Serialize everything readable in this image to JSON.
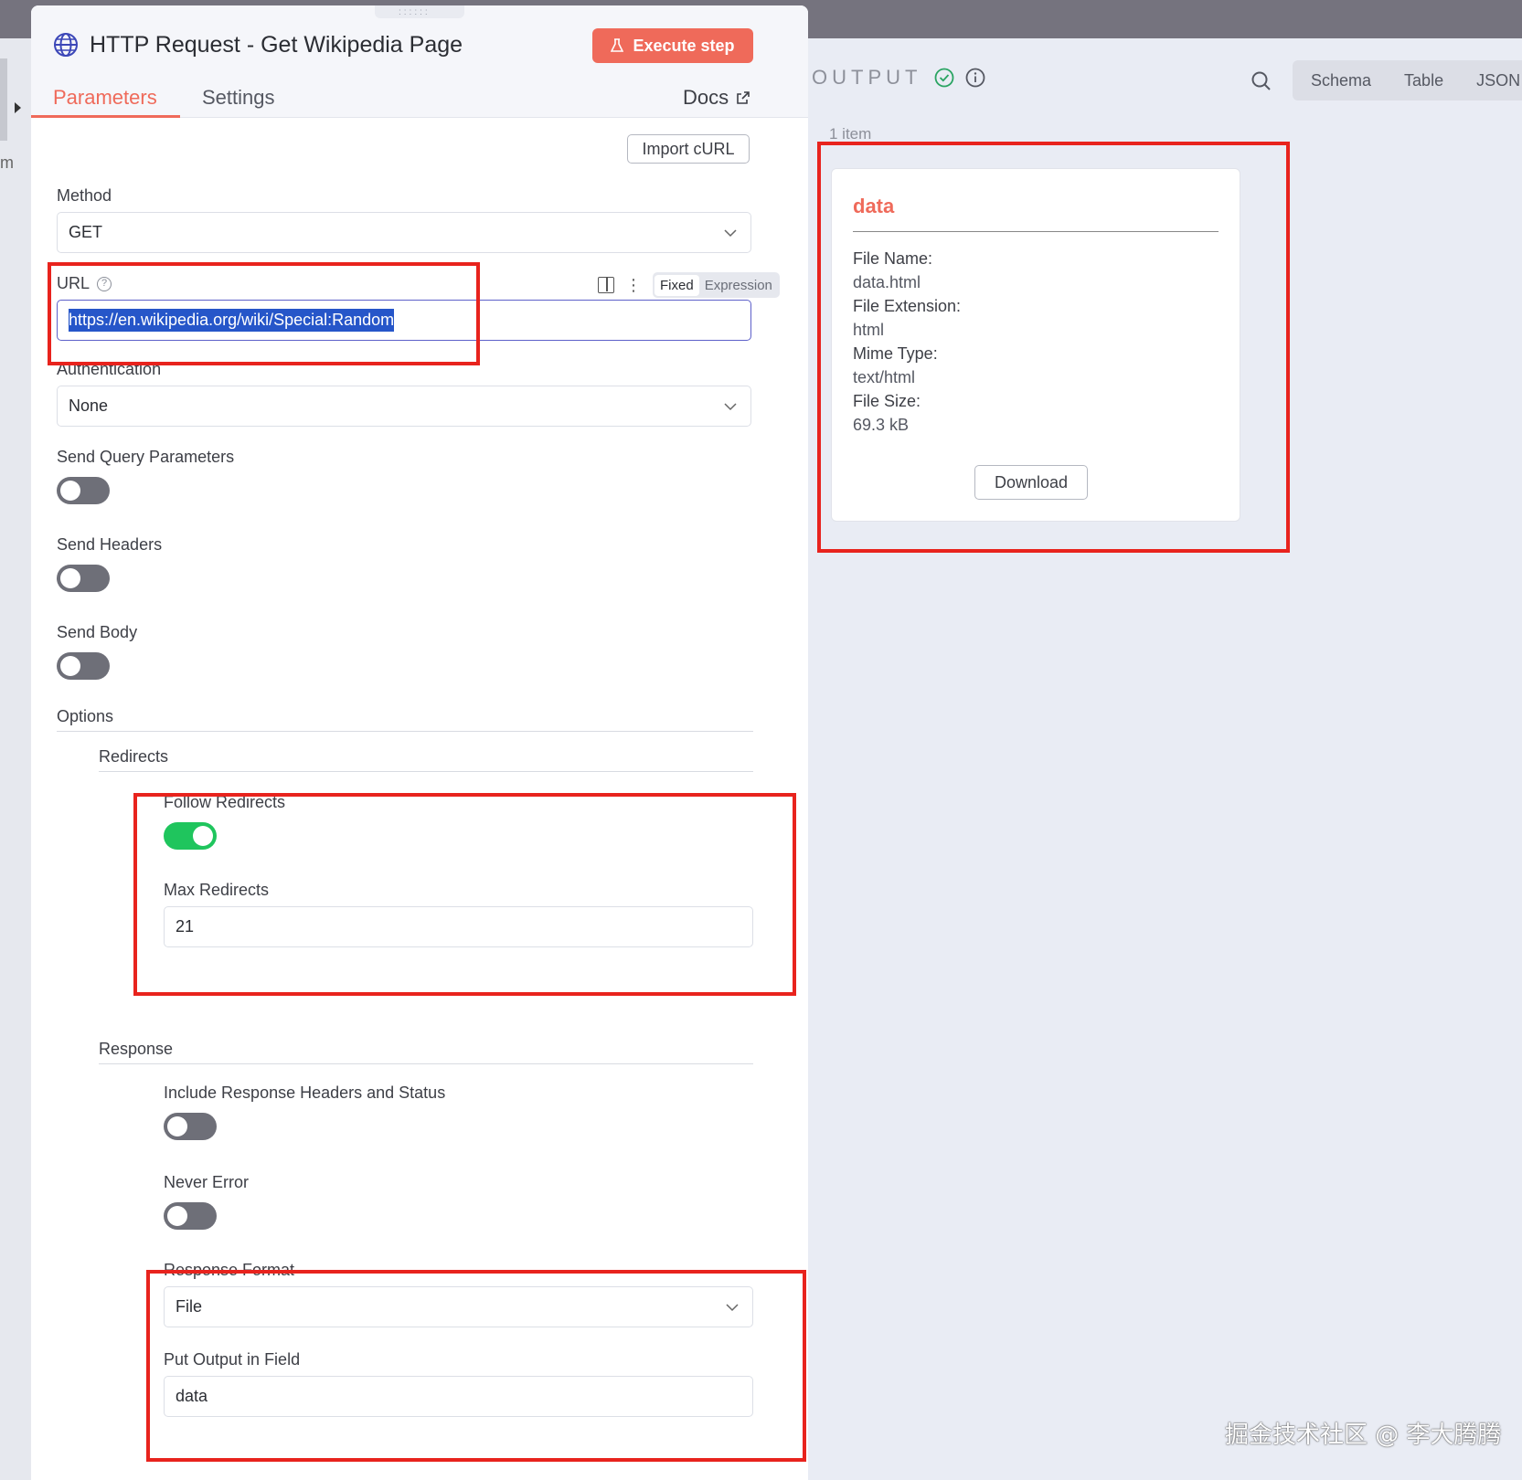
{
  "node": {
    "title": "HTTP Request - Get Wikipedia Page",
    "execute_label": "Execute step",
    "tabs": [
      "Parameters",
      "Settings"
    ],
    "docs_label": "Docs",
    "import_curl_label": "Import cURL"
  },
  "params": {
    "method": {
      "label": "Method",
      "value": "GET"
    },
    "url": {
      "label": "URL",
      "value": "https://en.wikipedia.org/wiki/Special:Random",
      "fixed_label": "Fixed",
      "expression_label": "Expression"
    },
    "auth": {
      "label": "Authentication",
      "value": "None"
    },
    "send_query": {
      "label": "Send Query Parameters",
      "on": false
    },
    "send_headers": {
      "label": "Send Headers",
      "on": false
    },
    "send_body": {
      "label": "Send Body",
      "on": false
    },
    "options_label": "Options",
    "redirects": {
      "label": "Redirects",
      "follow": {
        "label": "Follow Redirects",
        "on": true
      },
      "max": {
        "label": "Max Redirects",
        "value": "21"
      }
    },
    "response": {
      "label": "Response",
      "include_headers": {
        "label": "Include Response Headers and Status",
        "on": false
      },
      "never_error": {
        "label": "Never Error",
        "on": false
      },
      "format": {
        "label": "Response Format",
        "value": "File"
      },
      "output_field": {
        "label": "Put Output in Field",
        "value": "data"
      }
    }
  },
  "output": {
    "title": "OUTPUT",
    "view_tabs": [
      "Schema",
      "Table",
      "JSON"
    ],
    "items_count": "1 item",
    "card": {
      "title": "data",
      "fields": [
        {
          "key": "File Name:",
          "value": "data.html"
        },
        {
          "key": "File Extension:",
          "value": "html"
        },
        {
          "key": "Mime Type:",
          "value": "text/html"
        },
        {
          "key": "File Size:",
          "value": "69.3 kB"
        }
      ],
      "download_label": "Download"
    }
  },
  "sidebar": {
    "partial_char": "m"
  },
  "watermark": "掘金技术社区 @ 李大腾腾",
  "colors": {
    "accent": "#ef6a5a",
    "toggle_on": "#1fc55d",
    "highlight": "#e8231d",
    "selection": "#2656c9"
  }
}
